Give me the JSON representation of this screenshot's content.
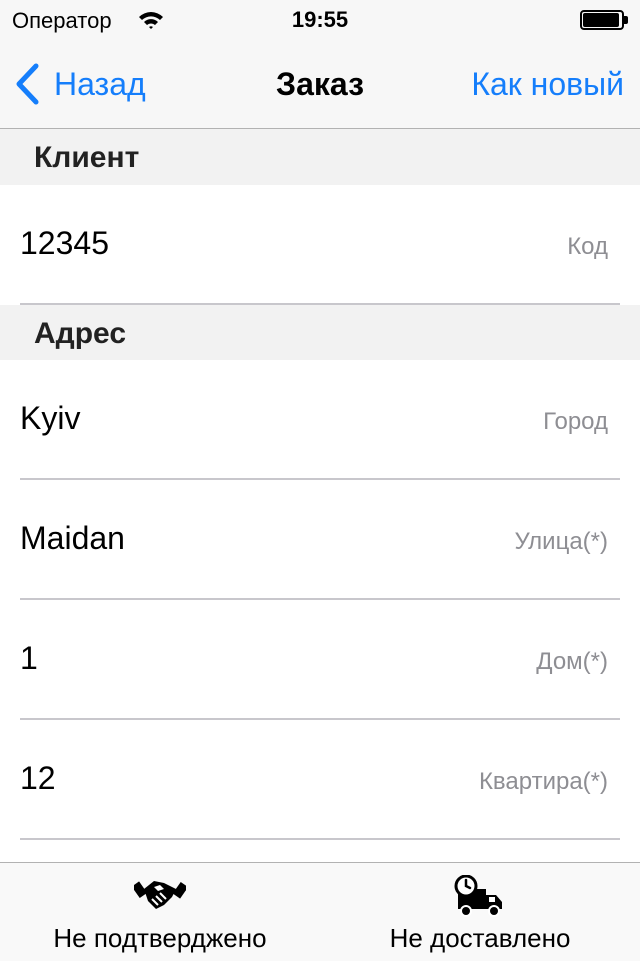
{
  "status_bar": {
    "carrier": "Оператор",
    "time": "19:55"
  },
  "nav": {
    "back_label": "Назад",
    "title": "Заказ",
    "action_label": "Как новый"
  },
  "sections": {
    "client": {
      "title": "Клиент",
      "fields": [
        {
          "value": "12345",
          "placeholder": "Код"
        }
      ]
    },
    "address": {
      "title": "Адрес",
      "fields": [
        {
          "value": "Kyiv",
          "placeholder": "Город"
        },
        {
          "value": "Maidan",
          "placeholder": "Улица(*)"
        },
        {
          "value": "1",
          "placeholder": "Дом(*)"
        },
        {
          "value": "12",
          "placeholder": "Квартира(*)"
        }
      ]
    }
  },
  "tabs": [
    {
      "label": "Не подтверджено",
      "icon": "handshake-icon"
    },
    {
      "label": "Не доставлено",
      "icon": "delivery-truck-clock-icon"
    }
  ],
  "colors": {
    "accent": "#157efb",
    "placeholder": "#8e8e93",
    "section_bg": "#f2f2f2"
  }
}
